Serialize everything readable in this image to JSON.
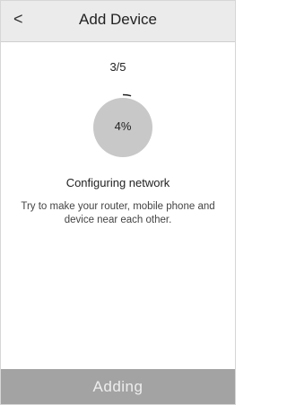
{
  "header": {
    "back_glyph": "<",
    "title": "Add Device"
  },
  "progress": {
    "step_text": "3/5",
    "percent_text": "4%",
    "percent_value": 4,
    "circle_color": "#c8c8c8",
    "arc_color": "#222222"
  },
  "status": {
    "title": "Configuring network",
    "hint": "Try to make your router, mobile phone and device near each other."
  },
  "footer": {
    "button_label": "Adding",
    "button_color": "#a3a3a3"
  }
}
